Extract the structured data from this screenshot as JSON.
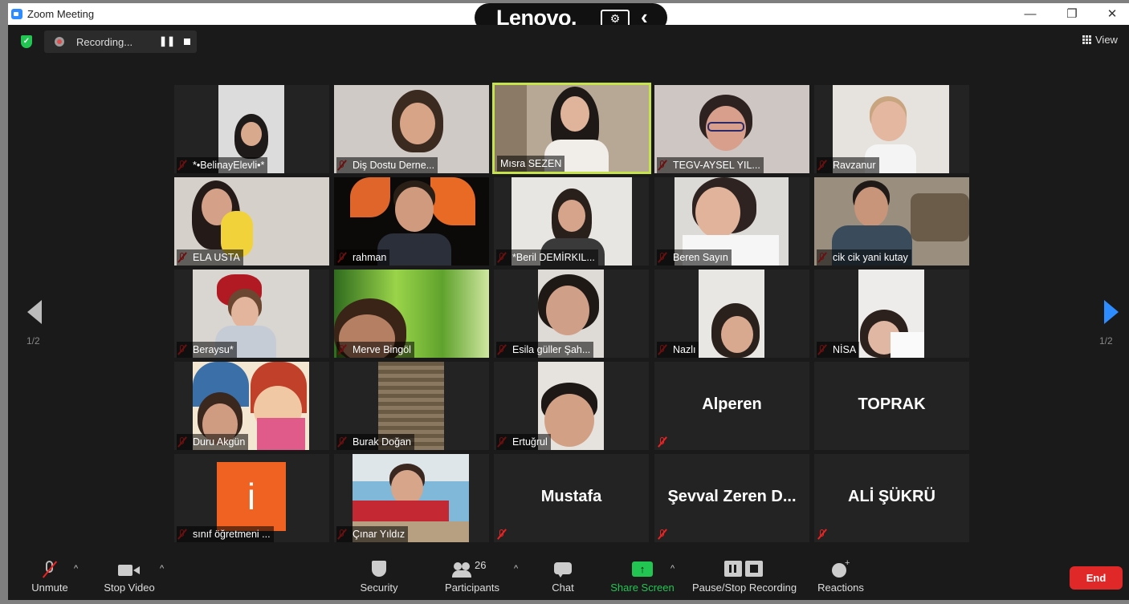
{
  "window": {
    "title": "Zoom Meeting",
    "minimize": "—",
    "restore": "❐",
    "close": "✕"
  },
  "lenovo_bar": {
    "brand": "Lenovo.",
    "icon": "⚙",
    "back": "‹"
  },
  "recording": {
    "text": "Recording...",
    "pause": "❚❚"
  },
  "view": {
    "label": "View"
  },
  "pagination": {
    "left": "1/2",
    "right": "1/2"
  },
  "participants": [
    {
      "name": "*•BelinayElevli•*"
    },
    {
      "name": "Diş Dostu Derne..."
    },
    {
      "name": "Mısra SEZEN"
    },
    {
      "name": "TEGV-AYSEL YIL..."
    },
    {
      "name": "Ravzanur"
    },
    {
      "name": "ELA USTA"
    },
    {
      "name": "rahman"
    },
    {
      "name": "*Beril DEMİRKIL..."
    },
    {
      "name": "Beren Sayın"
    },
    {
      "name": "cik cik yani kutay"
    },
    {
      "name": "Beraysu*"
    },
    {
      "name": "Merve Bingöl"
    },
    {
      "name": "Esila güller Şah..."
    },
    {
      "name": "Nazlı"
    },
    {
      "name": "NİSA"
    },
    {
      "name": "Duru Akgün"
    },
    {
      "name": "Burak Doğan"
    },
    {
      "name": "Ertuğrul"
    },
    {
      "name": "Alperen"
    },
    {
      "name": "TOPRAK"
    },
    {
      "name": "sınıf öğretmeni ...",
      "avatar_letter": "i"
    },
    {
      "name": "Çınar Yıldız"
    },
    {
      "name": "Mustafa"
    },
    {
      "name": "Şevval Zeren D..."
    },
    {
      "name": "ALİ ŞÜKRÜ"
    }
  ],
  "toolbar": {
    "unmute": "Unmute",
    "stop_video": "Stop Video",
    "security": "Security",
    "participants": "Participants",
    "participants_count": "26",
    "chat": "Chat",
    "share_screen": "Share Screen",
    "pause_stop_recording": "Pause/Stop Recording",
    "reactions": "Reactions",
    "end": "End",
    "caret": "^"
  },
  "colors": {
    "accent_share": "#23c552",
    "end_button": "#e02828",
    "active_speaker_border": "#c7e34a",
    "next_arrow": "#2d8cff"
  }
}
